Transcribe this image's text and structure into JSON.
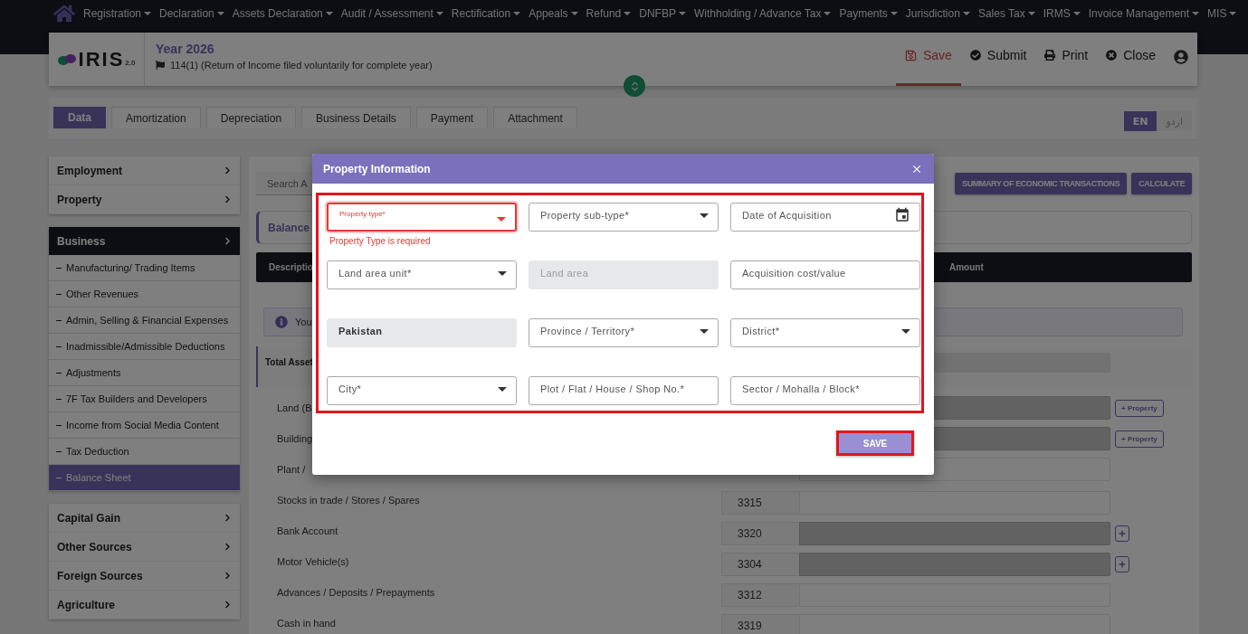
{
  "nav": {
    "items": [
      {
        "label": "Registration"
      },
      {
        "label": "Declaration"
      },
      {
        "label": "Assets Declaration"
      },
      {
        "label": "Audit / Assessment"
      },
      {
        "label": "Rectification"
      },
      {
        "label": "Appeals"
      },
      {
        "label": "Refund"
      },
      {
        "label": "DNFBP"
      },
      {
        "label": "Withholding / Advance Tax"
      },
      {
        "label": "Payments"
      },
      {
        "label": "Jurisdiction"
      },
      {
        "label": "Sales Tax"
      },
      {
        "label": "IRMS"
      },
      {
        "label": "Invoice Management"
      },
      {
        "label": "MIS"
      }
    ]
  },
  "header": {
    "logo": "IRIS",
    "logo_version": "2.0",
    "year": "Year 2026",
    "return_type": "114(1) (Return of Income filed voluntarily for complete year)",
    "actions": [
      {
        "kind": "save",
        "label": "Save",
        "selected": true
      },
      {
        "kind": "submit",
        "label": "Submit",
        "selected": false
      },
      {
        "kind": "print",
        "label": "Print",
        "selected": false
      },
      {
        "kind": "close",
        "label": "Close",
        "selected": false
      }
    ]
  },
  "tabs": [
    {
      "label": "Data",
      "selected": true
    },
    {
      "label": "Amortization",
      "selected": false
    },
    {
      "label": "Depreciation",
      "selected": false
    },
    {
      "label": "Business Details",
      "selected": false
    },
    {
      "label": "Payment",
      "selected": false
    },
    {
      "label": "Attachment",
      "selected": false
    }
  ],
  "language": [
    {
      "label": "EN",
      "selected": true
    },
    {
      "label": "اردو",
      "selected": false
    }
  ],
  "sidebar": {
    "groups": [
      {
        "items": [
          {
            "label": "Employment",
            "kind": "link"
          },
          {
            "label": "Property",
            "kind": "link"
          }
        ]
      },
      {
        "items": [
          {
            "label": "Business",
            "kind": "header",
            "expanded": true,
            "children": [
              {
                "label": "Manufacturing/ Trading Items",
                "selected": false
              },
              {
                "label": "Other Revenues",
                "selected": false
              },
              {
                "label": "Admin, Selling & Financial Expenses",
                "selected": false
              },
              {
                "label": "Inadmissible/Admissible Deductions",
                "selected": false
              },
              {
                "label": "Adjustments",
                "selected": false
              },
              {
                "label": "7F Tax Builders and Developers",
                "selected": false
              },
              {
                "label": "Income from Social Media Content",
                "selected": false
              },
              {
                "label": "Tax Deduction",
                "selected": false
              },
              {
                "label": "Balance Sheet",
                "selected": true
              }
            ]
          }
        ]
      },
      {
        "items": [
          {
            "label": "Capital Gain",
            "kind": "link"
          },
          {
            "label": "Other Sources",
            "kind": "link"
          },
          {
            "label": "Foreign Sources",
            "kind": "link"
          },
          {
            "label": "Agriculture",
            "kind": "link"
          }
        ]
      }
    ]
  },
  "main": {
    "search": {
      "placeholder": "Search A"
    },
    "buttons": [
      {
        "label": "SUMMARY OF ECONOMIC TRANSACTIONS"
      },
      {
        "label": "CALCULATE"
      }
    ],
    "section_title": "Balance",
    "table_header": {
      "column_1": "Descriptio",
      "column_2": "Amount"
    },
    "notice": "You",
    "total_label": "Total Asset",
    "rows": [
      {
        "label": "Land (B",
        "disabled": true,
        "action": {
          "kind": "property",
          "label": "+ Property"
        }
      },
      {
        "label": "Building",
        "disabled": true,
        "action": {
          "kind": "property",
          "label": "+ Property"
        }
      },
      {
        "label": "Plant /",
        "disabled": false
      },
      {
        "label": "Stocks in trade / Stores / Spares",
        "code": "3315",
        "disabled": false
      },
      {
        "label": "Bank Account",
        "code": "3320",
        "disabled": true,
        "action": {
          "kind": "add"
        }
      },
      {
        "label": "Motor Vehicle(s)",
        "code": "3304",
        "disabled": true,
        "action": {
          "kind": "add"
        }
      },
      {
        "label": "Advances / Deposits / Prepayments",
        "code": "3312",
        "disabled": false
      },
      {
        "label": "Cash in hand",
        "code": "3319",
        "disabled": false
      }
    ]
  },
  "modal": {
    "title": "Property Information",
    "highlighted": true,
    "fields": [
      {
        "kind": "select",
        "label": "Property type*",
        "invalid": true,
        "error": "Property Type is required"
      },
      {
        "kind": "select",
        "placeholder": "Property sub-type*",
        "invalid": false
      },
      {
        "kind": "date",
        "placeholder": "Date of Acquisition",
        "invalid": false
      },
      {
        "kind": "select",
        "placeholder": "Land area unit*",
        "invalid": false
      },
      {
        "kind": "input",
        "placeholder": "Land area",
        "disabled": true,
        "invalid": false
      },
      {
        "kind": "input",
        "placeholder": "Acquisition cost/value",
        "disabled": false,
        "invalid": false
      },
      {
        "kind": "input",
        "value": "Pakistan",
        "disabled": true,
        "invalid": false
      },
      {
        "kind": "select",
        "placeholder": "Province / Territory*",
        "invalid": false
      },
      {
        "kind": "select",
        "placeholder": "District*",
        "invalid": false
      },
      {
        "kind": "select",
        "placeholder": "City*",
        "invalid": false
      },
      {
        "kind": "input",
        "placeholder": "Plot / Flat / House / Shop No.*",
        "disabled": false,
        "invalid": false
      },
      {
        "kind": "input",
        "placeholder": "Sector / Mohalla / Block*",
        "disabled": false,
        "invalid": false
      }
    ],
    "save": {
      "label": "SAVE",
      "highlighted": true
    }
  }
}
